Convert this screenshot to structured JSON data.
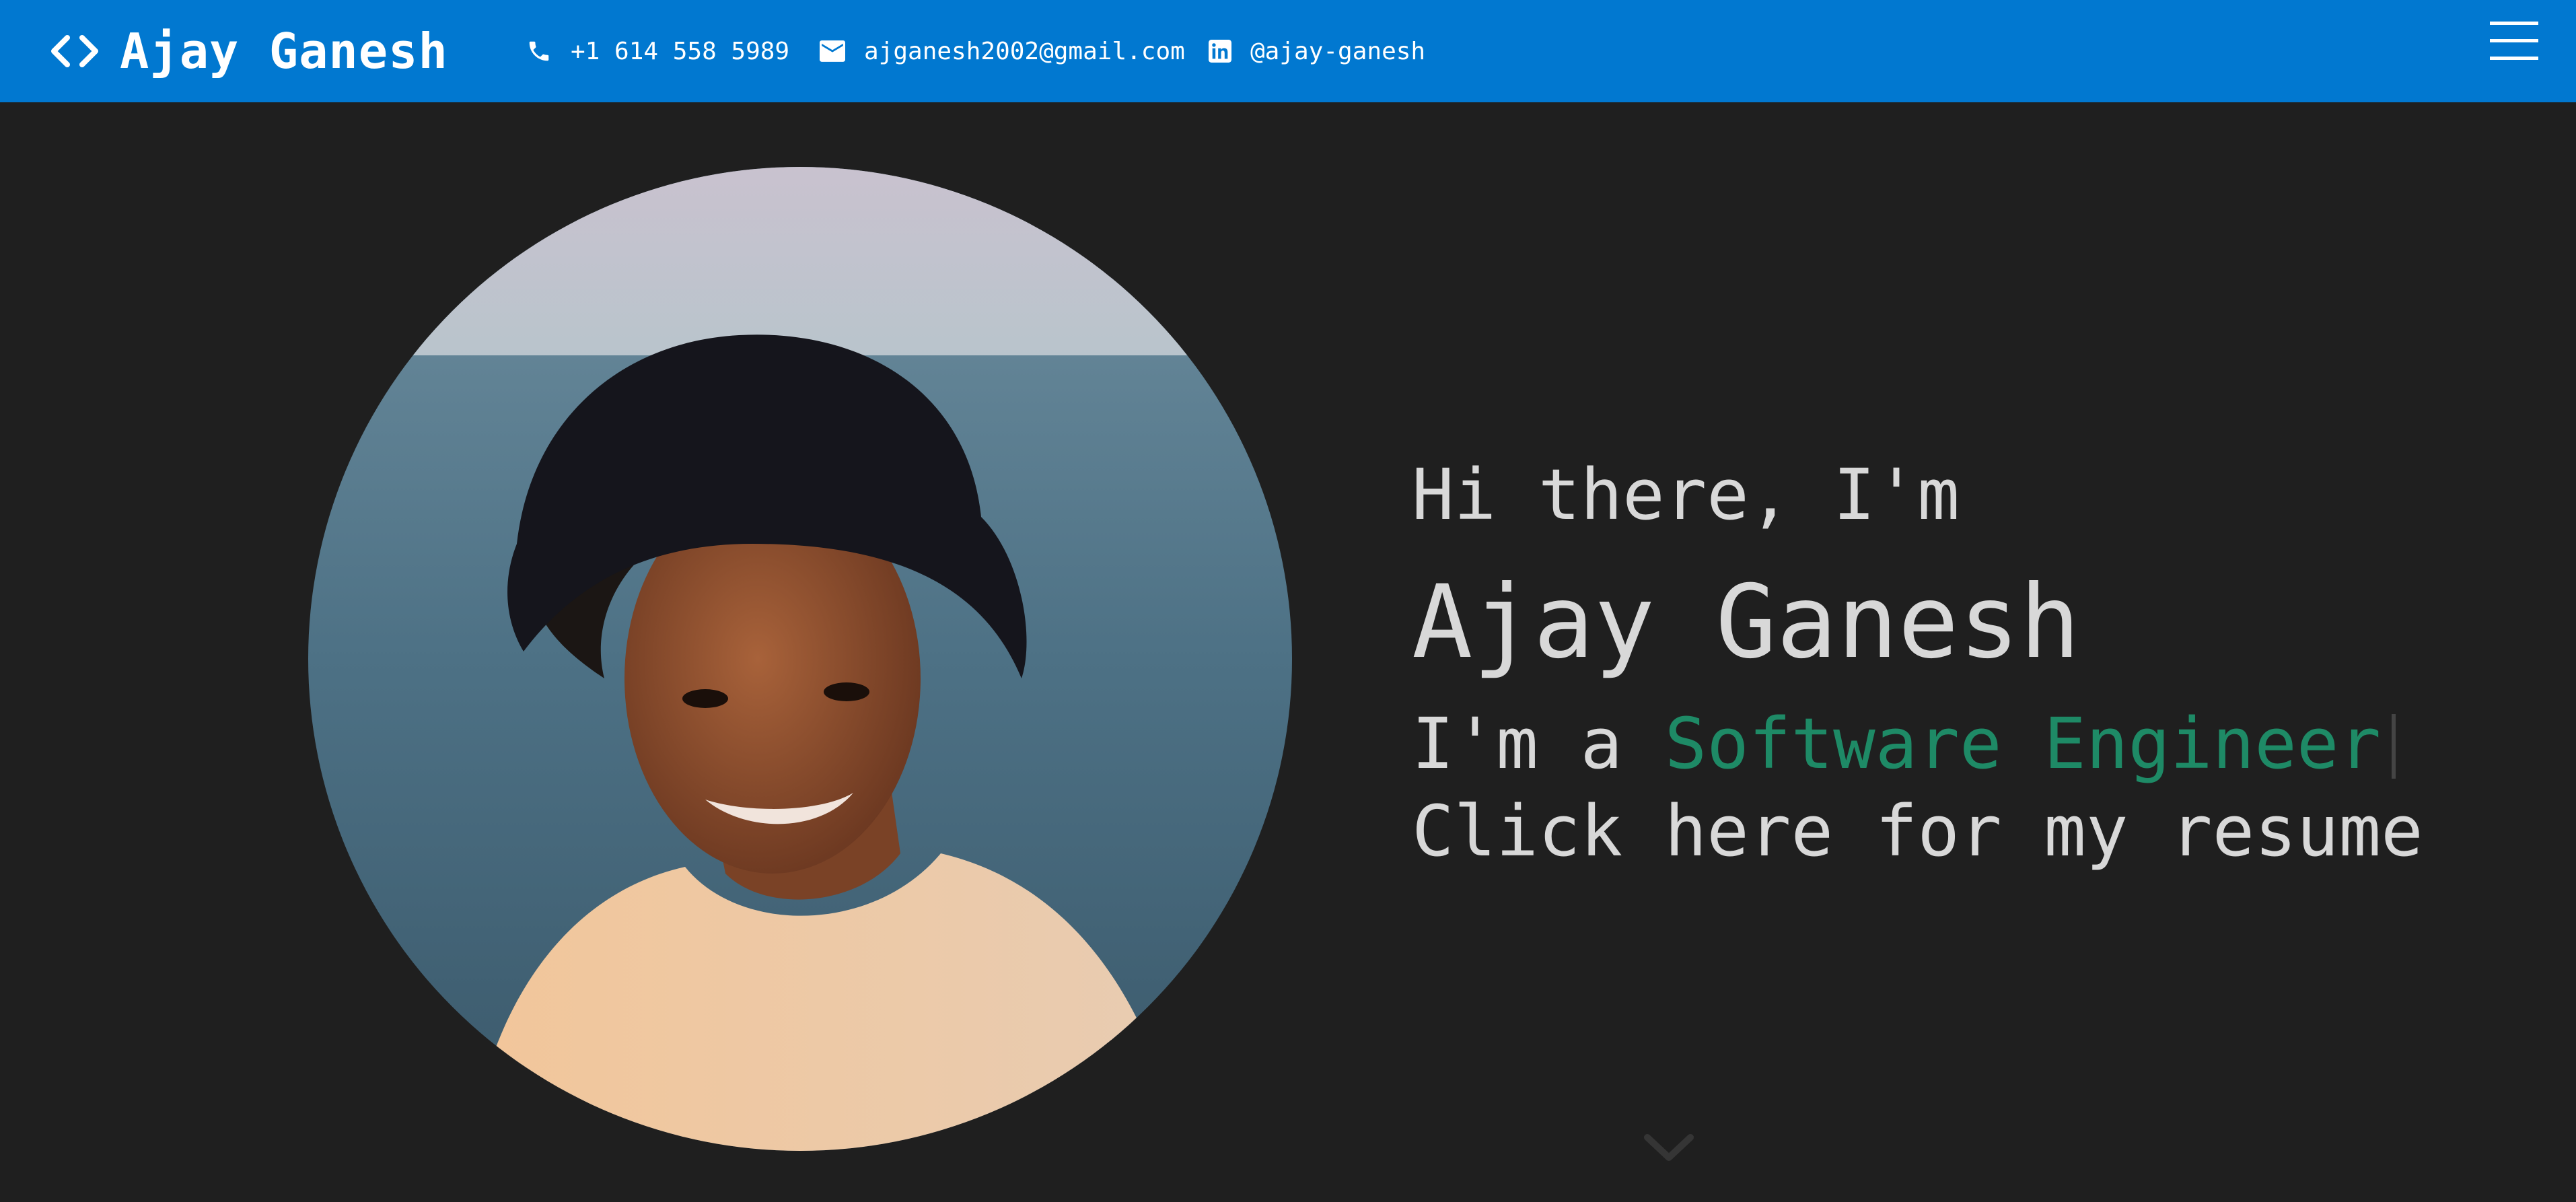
{
  "header": {
    "brand_name": "Ajay Ganesh",
    "brand_icon": "code-icon",
    "phone": "+1 614 558 5989",
    "email": "ajganesh2002@gmail.com",
    "linkedin": "@ajay-ganesh",
    "menu_icon": "hamburger-menu-icon"
  },
  "hero": {
    "greeting": "Hi there, I'm",
    "name": "Ajay Ganesh",
    "role_prefix": "I'm a ",
    "role": "Software Engineer",
    "resume_link": "Click here for my resume",
    "scroll_icon": "chevron-down-icon"
  },
  "colors": {
    "header_bg": "#0178d0",
    "page_bg": "#1f1f1f",
    "text": "#d8d8d8",
    "accent": "#1e8a66"
  }
}
